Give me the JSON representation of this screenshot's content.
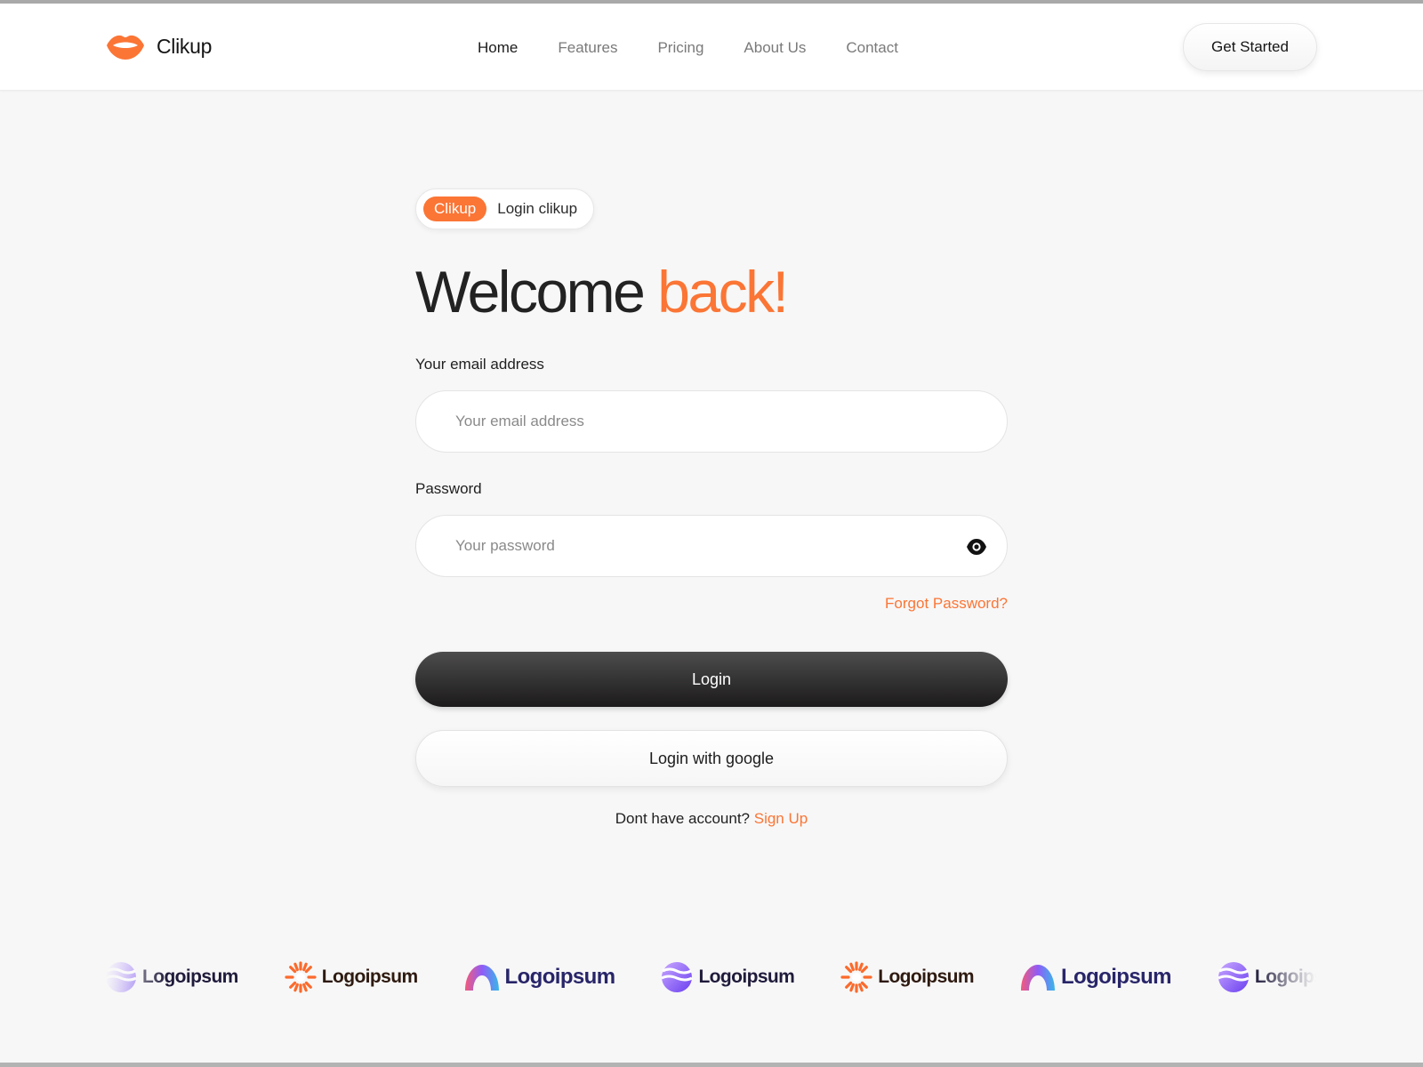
{
  "brand": {
    "name": "Clikup",
    "accent_color": "#fb7535",
    "logo_icon": "lips-logo-icon"
  },
  "nav": {
    "items": [
      {
        "label": "Home",
        "active": true
      },
      {
        "label": "Features",
        "active": false
      },
      {
        "label": "Pricing",
        "active": false
      },
      {
        "label": "About Us",
        "active": false
      },
      {
        "label": "Contact",
        "active": false
      }
    ],
    "cta_label": "Get Started"
  },
  "form": {
    "badge_tag": "Clikup",
    "badge_text": "Login clikup",
    "title_main": "Welcome",
    "title_accent": "back!",
    "email_label": "Your email address",
    "email_placeholder": "Your email address",
    "email_value": "",
    "password_label": "Password",
    "password_placeholder": "Your password",
    "password_value": "",
    "password_toggle_icon": "eye-icon",
    "forgot_label": "Forgot Password?",
    "login_label": "Login",
    "google_label": "Login with google",
    "signup_prompt": "Dont have account?",
    "signup_link": "Sign Up"
  },
  "partners": {
    "logos": [
      {
        "name": "Logoipsum",
        "icon": "stripes-globe-icon"
      },
      {
        "name": "Logoipsum",
        "icon": "sunburst-icon"
      },
      {
        "name": "Logoipsum",
        "icon": "rainbow-arch-icon"
      },
      {
        "name": "Logoipsum",
        "icon": "stripes-globe-icon"
      },
      {
        "name": "Logoipsum",
        "icon": "sunburst-icon"
      },
      {
        "name": "Logoipsum",
        "icon": "rainbow-arch-icon"
      },
      {
        "name": "Logoipsum",
        "icon": "stripes-globe-icon"
      }
    ]
  }
}
